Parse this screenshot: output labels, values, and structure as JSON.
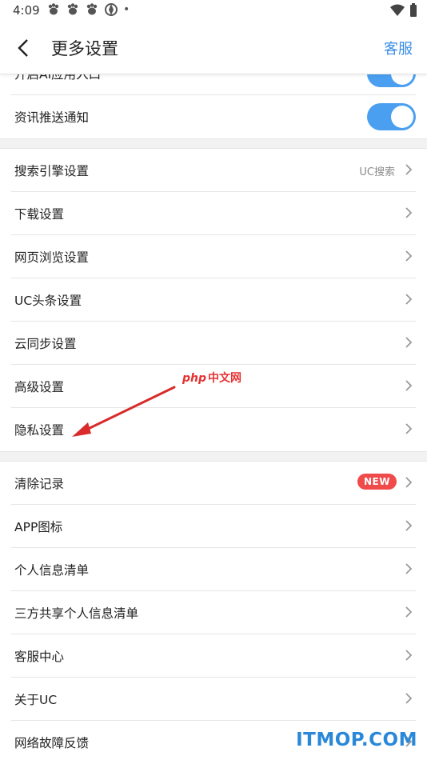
{
  "status_bar": {
    "time": "4:09",
    "dot": "•"
  },
  "header": {
    "title": "更多设置",
    "service_label": "客服"
  },
  "sections": {
    "toggles": [
      {
        "label": "开启AI应用入口",
        "on": true
      },
      {
        "label": "资讯推送通知",
        "on": true
      }
    ],
    "settings": [
      {
        "label": "搜索引擎设置",
        "value": "UC搜索"
      },
      {
        "label": "下载设置"
      },
      {
        "label": "网页浏览设置"
      },
      {
        "label": "UC头条设置"
      },
      {
        "label": "云同步设置"
      },
      {
        "label": "高级设置"
      },
      {
        "label": "隐私设置"
      }
    ],
    "misc": [
      {
        "label": "清除记录",
        "badge": "NEW"
      },
      {
        "label": "APP图标"
      },
      {
        "label": "个人信息清单"
      },
      {
        "label": "三方共享个人信息清单"
      },
      {
        "label": "客服中心"
      },
      {
        "label": "关于UC"
      },
      {
        "label": "网络故障反馈"
      }
    ]
  },
  "watermarks": {
    "php_latin": "php",
    "php_cn": "中文网",
    "itmop": "ITMOP.COM"
  },
  "colors": {
    "accent": "#3a8ee6",
    "toggle_on": "#4a9ff0",
    "badge": "#f04a4a",
    "arrow": "#d92b2b"
  }
}
